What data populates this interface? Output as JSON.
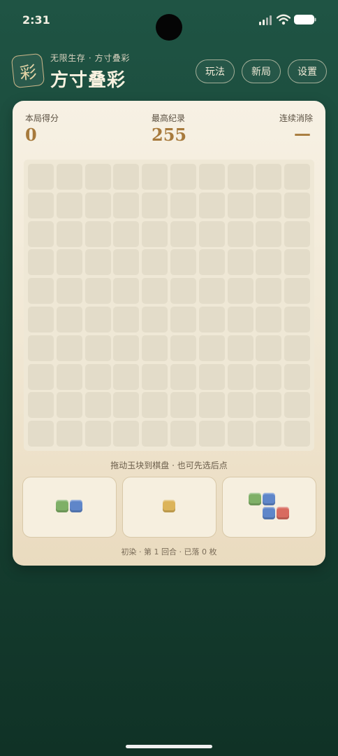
{
  "status_bar": {
    "time": "2:31"
  },
  "header": {
    "logo_char": "彩",
    "subtitle": "无限生存 · 方寸叠彩",
    "title": "方寸叠彩",
    "buttons": {
      "rules": "玩法",
      "new_game": "新局",
      "settings": "设置"
    }
  },
  "stats": {
    "score_label": "本局得分",
    "score_value": "0",
    "best_label": "最高纪录",
    "best_value": "255",
    "combo_label": "连续消除",
    "combo_value": "—"
  },
  "board": {
    "rows": 10,
    "cols": 10,
    "filled_cells": 0
  },
  "hint": "拖动玉块到棋盘 · 也可先选后点",
  "tray": {
    "pieces": [
      {
        "name": "piece-1-green-blue",
        "colors": [
          "#7fb067",
          "#5f86c9"
        ]
      },
      {
        "name": "piece-2-yellow",
        "colors": [
          "#dcb45a"
        ]
      },
      {
        "name": "piece-3-s-shape",
        "colors": [
          "#7fb067",
          "#5f86c9",
          "#5f86c9",
          "#d86b5f"
        ]
      }
    ]
  },
  "footer": "初染 · 第 1 回合 · 已落 0 枚",
  "colors": {
    "background": "#184536",
    "card": "#f3ebd9",
    "accent_gold": "#a77a3c",
    "green": "#7fb067",
    "blue": "#5f86c9",
    "yellow": "#dcb45a",
    "red": "#d86b5f"
  }
}
